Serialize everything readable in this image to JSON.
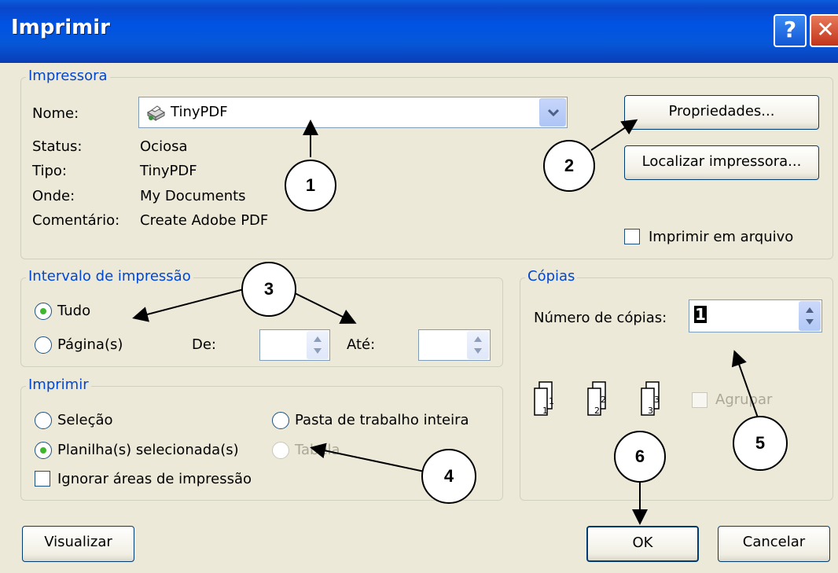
{
  "window": {
    "title": "Imprimir",
    "help_glyph": "?",
    "close_glyph": "✕"
  },
  "printer": {
    "legend": "Impressora",
    "name_label": "Nome:",
    "name_value": "TinyPDF",
    "status_label": "Status:",
    "status_value": "Ociosa",
    "type_label": "Tipo:",
    "type_value": "TinyPDF",
    "where_label": "Onde:",
    "where_value": "My Documents",
    "comment_label": "Comentário:",
    "comment_value": "Create Adobe PDF",
    "properties_button": "Propriedades...",
    "find_button": "Localizar impressora...",
    "print_to_file_label": "Imprimir em arquivo"
  },
  "range": {
    "legend": "Intervalo de impressão",
    "all_label": "Tudo",
    "pages_label": "Página(s)",
    "from_label": "De:",
    "to_label": "Até:"
  },
  "print_what": {
    "legend": "Imprimir",
    "selection_label": "Seleção",
    "whole_workbook_label": "Pasta de trabalho inteira",
    "active_sheets_label": "Planilha(s) selecionada(s)",
    "table_label": "Tabela",
    "ignore_areas_label": "Ignorar áreas de impressão"
  },
  "copies": {
    "legend": "Cópias",
    "count_label": "Número de cópias:",
    "count_value": "1",
    "collate_label": "Agrupar"
  },
  "buttons": {
    "preview": "Visualizar",
    "ok": "OK",
    "cancel": "Cancelar"
  },
  "annotations": [
    "1",
    "2",
    "3",
    "4",
    "5",
    "6"
  ]
}
